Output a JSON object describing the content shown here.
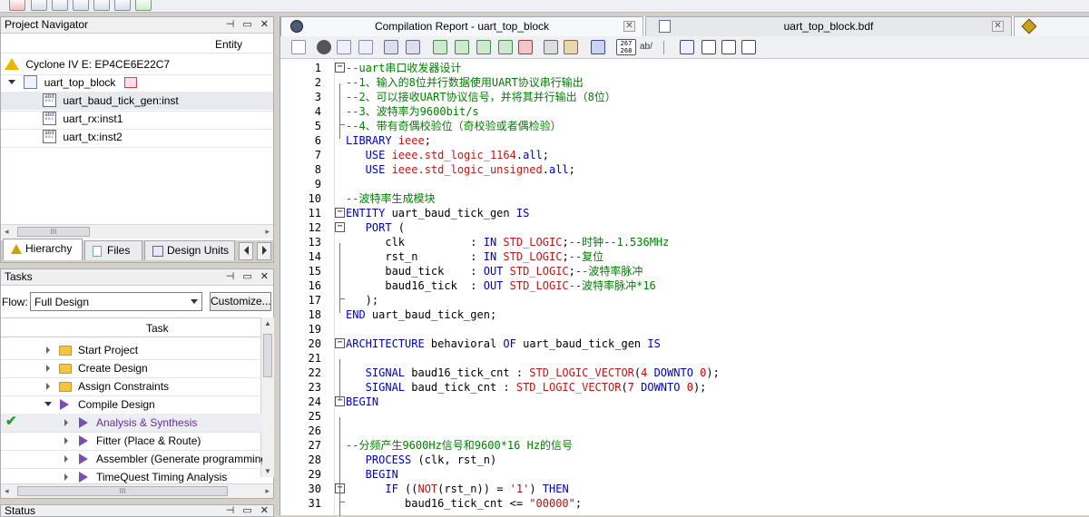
{
  "project_navigator": {
    "title": "Project Navigator",
    "column_entity": "Entity",
    "device": "Cyclone IV E: EP4CE6E22C7",
    "top_entity": "uart_top_block",
    "instances": [
      "uart_baud_tick_gen:inst",
      "uart_rx:inst1",
      "uart_tx:inst2"
    ],
    "scroll_thumb": "III",
    "tabs": [
      "Hierarchy",
      "Files",
      "Design Units"
    ]
  },
  "tasks": {
    "title": "Tasks",
    "flow_label": "Flow:",
    "flow_value": "Full Design",
    "customize_label": "Customize...",
    "column_task": "Task",
    "items": [
      {
        "label": "Start Project"
      },
      {
        "label": "Create Design"
      },
      {
        "label": "Assign Constraints"
      },
      {
        "label": "Compile Design"
      },
      {
        "label": "Analysis & Synthesis"
      },
      {
        "label": "Fitter (Place & Route)"
      },
      {
        "label": "Assembler (Generate programming file"
      },
      {
        "label": "TimeQuest Timing Analysis"
      }
    ],
    "scroll_thumb": "III"
  },
  "status": {
    "title": "Status"
  },
  "editor_tabs": [
    {
      "label": "Compilation Report - uart_top_block"
    },
    {
      "label": "uart_top_block.bdf"
    }
  ],
  "toolbar": {
    "line_counter": "267\n268",
    "ab_label": "ab/"
  },
  "colors": {
    "keyword": "#0000c8",
    "type": "#c81414",
    "comment": "#008000",
    "string": "#a31515"
  },
  "code": [
    {
      "n": "1",
      "t": [
        [
          "cm",
          "--uart串口收发器设计"
        ]
      ]
    },
    {
      "n": "2",
      "t": [
        [
          "cm",
          "--1、输入的8位并行数据使用UART协议串行输出"
        ]
      ]
    },
    {
      "n": "3",
      "t": [
        [
          "cm",
          "--2、可以接收UART协议信号，并将其并行输出（8位）"
        ]
      ]
    },
    {
      "n": "4",
      "t": [
        [
          "cm",
          "--3、波特率为9600bit/s"
        ]
      ]
    },
    {
      "n": "5",
      "t": [
        [
          "cm",
          "--4、带有奇偶校验位（奇校验或者偶检验）"
        ]
      ]
    },
    {
      "n": "6",
      "t": [
        [
          "kw",
          "LIBRARY "
        ],
        [
          "ty",
          "ieee"
        ],
        [
          "tx",
          ";"
        ]
      ]
    },
    {
      "n": "7",
      "t": [
        [
          "kw",
          "   USE "
        ],
        [
          "ty",
          "ieee.std_logic_1164"
        ],
        [
          "tx",
          "."
        ],
        [
          "kw",
          "all"
        ],
        [
          "tx",
          ";"
        ]
      ]
    },
    {
      "n": "8",
      "t": [
        [
          "kw",
          "   USE "
        ],
        [
          "ty",
          "ieee.std_logic_unsigned"
        ],
        [
          "tx",
          "."
        ],
        [
          "kw",
          "all"
        ],
        [
          "tx",
          ";"
        ]
      ]
    },
    {
      "n": "9",
      "t": []
    },
    {
      "n": "10",
      "t": [
        [
          "cm",
          "--波特率生成模块"
        ]
      ]
    },
    {
      "n": "11",
      "t": [
        [
          "kw",
          "ENTITY "
        ],
        [
          "tx",
          "uart_baud_tick_gen "
        ],
        [
          "kw",
          "IS"
        ]
      ]
    },
    {
      "n": "12",
      "t": [
        [
          "kw",
          "   PORT "
        ],
        [
          "tx",
          "("
        ]
      ]
    },
    {
      "n": "13",
      "t": [
        [
          "tx",
          "      clk          : "
        ],
        [
          "kw",
          "IN "
        ],
        [
          "ty",
          "STD_LOGIC"
        ],
        [
          "tx",
          ";"
        ],
        [
          "cm",
          "--时钟--1.536MHz"
        ]
      ]
    },
    {
      "n": "14",
      "t": [
        [
          "tx",
          "      rst_n        : "
        ],
        [
          "kw",
          "IN "
        ],
        [
          "ty",
          "STD_LOGIC"
        ],
        [
          "tx",
          ";"
        ],
        [
          "cm",
          "--复位"
        ]
      ]
    },
    {
      "n": "15",
      "t": [
        [
          "tx",
          "      baud_tick    : "
        ],
        [
          "kw",
          "OUT "
        ],
        [
          "ty",
          "STD_LOGIC"
        ],
        [
          "tx",
          ";"
        ],
        [
          "cm",
          "--波特率脉冲"
        ]
      ]
    },
    {
      "n": "16",
      "t": [
        [
          "tx",
          "      baud16_tick  : "
        ],
        [
          "kw",
          "OUT "
        ],
        [
          "ty",
          "STD_LOGIC"
        ],
        [
          "cm",
          "--波特率脉冲*16"
        ]
      ]
    },
    {
      "n": "17",
      "t": [
        [
          "tx",
          "   );"
        ]
      ]
    },
    {
      "n": "18",
      "t": [
        [
          "kw",
          "END "
        ],
        [
          "tx",
          "uart_baud_tick_gen;"
        ]
      ]
    },
    {
      "n": "19",
      "t": []
    },
    {
      "n": "20",
      "t": [
        [
          "kw",
          "ARCHITECTURE "
        ],
        [
          "tx",
          "behavioral "
        ],
        [
          "kw",
          "OF "
        ],
        [
          "tx",
          "uart_baud_tick_gen "
        ],
        [
          "kw",
          "IS"
        ]
      ]
    },
    {
      "n": "21",
      "t": []
    },
    {
      "n": "22",
      "t": [
        [
          "kw",
          "   SIGNAL "
        ],
        [
          "tx",
          "baud16_tick_cnt : "
        ],
        [
          "ty",
          "STD_LOGIC_VECTOR"
        ],
        [
          "tx",
          "("
        ],
        [
          "nm",
          "4"
        ],
        [
          "kw",
          " DOWNTO "
        ],
        [
          "nm",
          "0"
        ],
        [
          "tx",
          ");"
        ]
      ]
    },
    {
      "n": "23",
      "t": [
        [
          "kw",
          "   SIGNAL "
        ],
        [
          "tx",
          "baud_tick_cnt : "
        ],
        [
          "ty",
          "STD_LOGIC_VECTOR"
        ],
        [
          "tx",
          "("
        ],
        [
          "nm",
          "7"
        ],
        [
          "kw",
          " DOWNTO "
        ],
        [
          "nm",
          "0"
        ],
        [
          "tx",
          ");"
        ]
      ]
    },
    {
      "n": "24",
      "t": [
        [
          "kw",
          "BEGIN"
        ]
      ]
    },
    {
      "n": "25",
      "t": []
    },
    {
      "n": "26",
      "t": []
    },
    {
      "n": "27",
      "t": [
        [
          "cm",
          "--分频产生9600Hz信号和9600*16 Hz的信号"
        ]
      ]
    },
    {
      "n": "28",
      "t": [
        [
          "kw",
          "   PROCESS "
        ],
        [
          "tx",
          "(clk, rst_n)"
        ]
      ]
    },
    {
      "n": "29",
      "t": [
        [
          "kw",
          "   BEGIN"
        ]
      ]
    },
    {
      "n": "30",
      "t": [
        [
          "kw",
          "      IF "
        ],
        [
          "tx",
          "(("
        ],
        [
          "ty",
          "NOT"
        ],
        [
          "tx",
          "(rst_n)) = "
        ],
        [
          "st",
          "'1'"
        ],
        [
          "tx",
          ") "
        ],
        [
          "kw",
          "THEN"
        ]
      ]
    },
    {
      "n": "31",
      "t": [
        [
          "tx",
          "         baud16_tick_cnt <= "
        ],
        [
          "st",
          "\"00000\""
        ],
        [
          "tx",
          ";"
        ]
      ]
    }
  ]
}
